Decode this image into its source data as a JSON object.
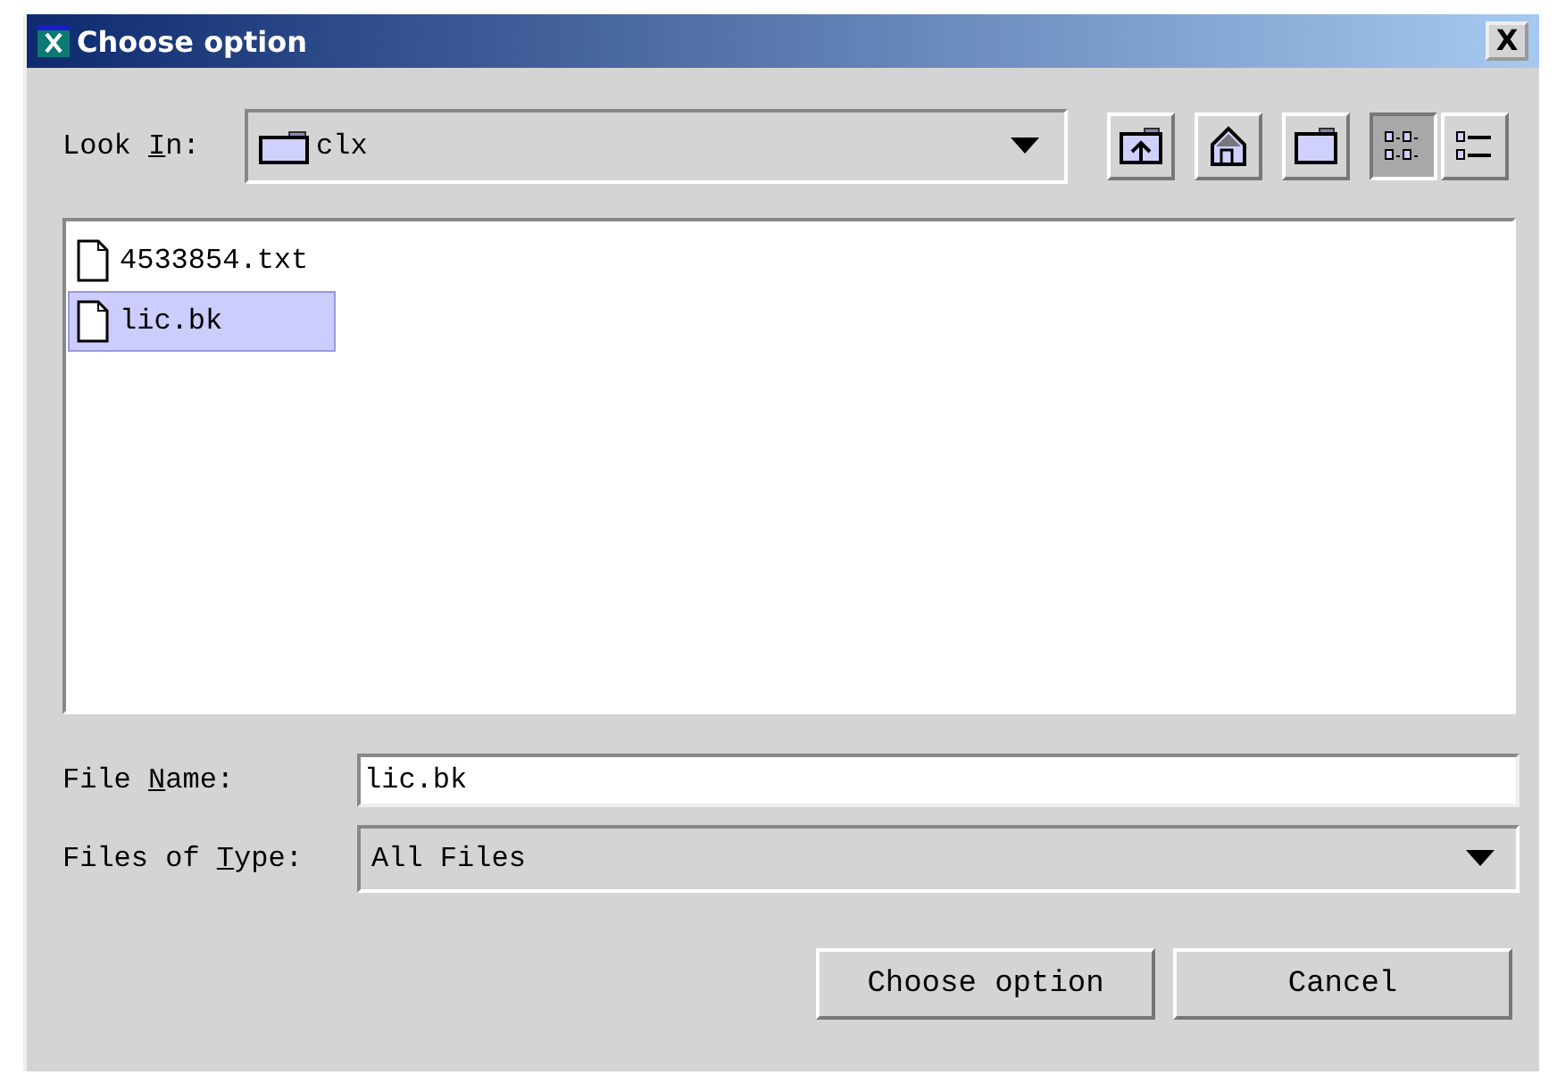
{
  "window": {
    "title": "Choose option",
    "close": "X"
  },
  "look_in": {
    "label": {
      "before": "Look ",
      "key": "I",
      "after": "n:"
    },
    "value": "clx"
  },
  "toolbar": [
    {
      "kind": "up",
      "selected": false
    },
    {
      "kind": "home",
      "selected": false
    },
    {
      "kind": "new-folder",
      "selected": false
    },
    {
      "kind": "list",
      "selected": true
    },
    {
      "kind": "details",
      "selected": false
    }
  ],
  "files": [
    {
      "name": "4533854.txt",
      "selected": false
    },
    {
      "name": "lic.bk",
      "selected": true
    }
  ],
  "file_name": {
    "label": {
      "before": "File ",
      "key": "N",
      "after": "ame:"
    },
    "value": "lic.bk"
  },
  "file_type": {
    "label": {
      "before": "Files of ",
      "key": "T",
      "after": "ype:"
    },
    "value": "All Files"
  },
  "buttons": [
    "Choose option",
    "Cancel"
  ]
}
